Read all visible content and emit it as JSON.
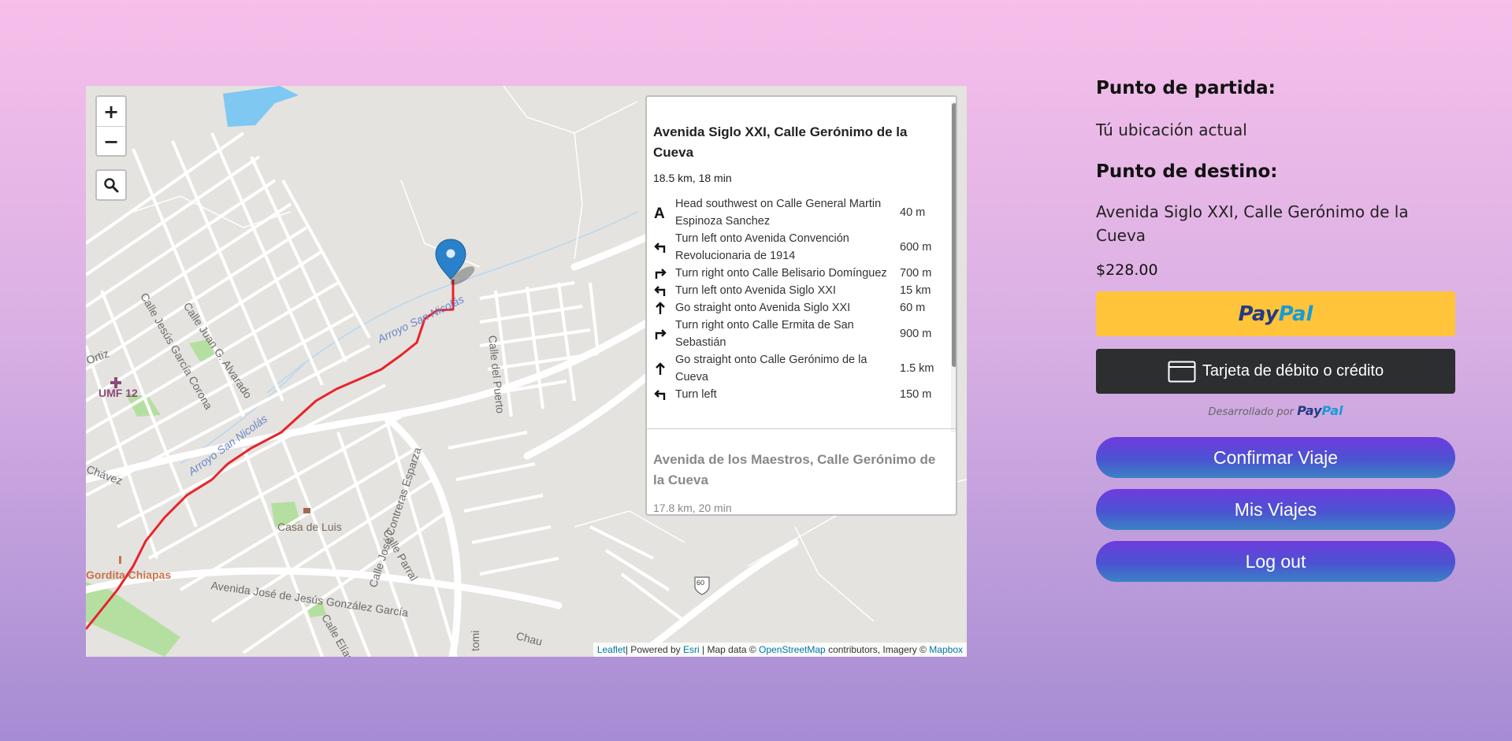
{
  "map": {
    "zoom_in": "+",
    "zoom_out": "−",
    "labels": {
      "arroyo1": "Arroyo San Nicolás",
      "arroyo2": "Arroyo San Nicolás",
      "calle_puerto": "Calle del Puerto",
      "jesus_garcia": "Calle Jesús García Corona",
      "juan_alvarado": "Calle Juan G. Alvarado",
      "ortiz": "Ortiz",
      "chavez": "Chávez",
      "umf": "UMF 12",
      "casa_luis": "Casa de Luis",
      "jose_contreras": "Calle José Contreras Esparza",
      "parral": "Calle Parral",
      "jose_gonzalez": "Avenida José de Jesús González García",
      "elias": "Calle Elías",
      "gordita": "Gordita Chiapas",
      "chau": "Chau",
      "toml": "tomi",
      "shield": "60"
    },
    "attribution": {
      "leaflet": "Leaflet",
      "powered": "| Powered by ",
      "esri": "Esri",
      "mapdata": " | Map data © ",
      "osm": "OpenStreetMap",
      "imagery": " contributors, Imagery © ",
      "mapbox": "Mapbox"
    }
  },
  "routing": {
    "alt1": {
      "title": "Avenida Siglo XXI, Calle Gerónimo de la Cueva",
      "summary": "18.5 km, 18 min",
      "steps": [
        {
          "icon": "depart-icon",
          "text": "Head southwest on Calle General Martin Espinoza Sanchez",
          "dist": "40 m"
        },
        {
          "icon": "turn-left-icon",
          "text": "Turn left onto Avenida Convención Revolucionaria de 1914",
          "dist": "600 m"
        },
        {
          "icon": "turn-right-icon",
          "text": "Turn right onto Calle Belisario Domínguez",
          "dist": "700 m"
        },
        {
          "icon": "turn-left-icon",
          "text": "Turn left onto Avenida Siglo XXI",
          "dist": "15 km"
        },
        {
          "icon": "straight-icon",
          "text": "Go straight onto Avenida Siglo XXI",
          "dist": "60 m"
        },
        {
          "icon": "turn-right-icon",
          "text": "Turn right onto Calle Ermita de San Sebastián",
          "dist": "900 m"
        },
        {
          "icon": "straight-icon",
          "text": "Go straight onto Calle Gerónimo de la Cueva",
          "dist": "1.5 km"
        },
        {
          "icon": "turn-left-icon",
          "text": "Turn left",
          "dist": "150 m"
        }
      ]
    },
    "alt2": {
      "title": "Avenida de los Maestros, Calle Gerónimo de la Cueva",
      "summary": "17.8 km, 20 min"
    }
  },
  "side": {
    "origin_label": "Punto de partida:",
    "origin_value": "Tú ubicación actual",
    "dest_label": "Punto de destino:",
    "dest_value": "Avenida Siglo XXI, Calle Gerónimo de la Cueva",
    "price": "$228.00",
    "paypal_pay": "Pay",
    "paypal_pal": "Pal",
    "card_button": "Tarjeta de débito o crédito",
    "powered_by": "Desarrollado por",
    "powered_pay": "Pay",
    "powered_pal": "Pal",
    "confirm": "Confirmar Viaje",
    "my_trips": "Mis Viajes",
    "logout": "Log out"
  },
  "colors": {
    "route": "#e8232c",
    "marker": "#2a81cb",
    "paypal_yellow": "#ffc43a",
    "card_dark": "#2c2e2f"
  }
}
